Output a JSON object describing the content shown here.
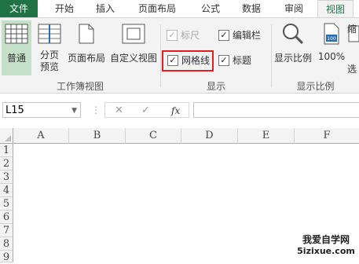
{
  "tabs": [
    "文件",
    "开始",
    "插入",
    "页面布局",
    "公式",
    "数据",
    "审阅",
    "视图"
  ],
  "active_tab": "视图",
  "workbook_views": {
    "group_label": "工作簿视图",
    "normal": "普通",
    "page_break_1": "分页",
    "page_break_2": "预览",
    "page_layout": "页面布局",
    "custom_views": "自定义视图"
  },
  "show": {
    "group_label": "显示",
    "ruler": {
      "label": "标尺",
      "checked": true,
      "disabled": true
    },
    "formula_bar": {
      "label": "编辑栏",
      "checked": true
    },
    "gridlines": {
      "label": "网格线",
      "checked": true
    },
    "headings": {
      "label": "标题",
      "checked": true
    }
  },
  "zoom": {
    "group_label": "显示比例",
    "zoom_label": "显示比例",
    "hundred_label": "100%",
    "hundred_icon_text": "100",
    "selection_1": "缩",
    "selection_2": "选"
  },
  "formula_bar": {
    "name_box_value": "L15",
    "cancel_symbol": "✕",
    "enter_symbol": "✓",
    "fx_symbol": "fx",
    "formula_value": ""
  },
  "columns": [
    "A",
    "B",
    "C",
    "D",
    "E",
    "F"
  ],
  "rows": [
    "1",
    "2",
    "3",
    "4",
    "5",
    "6",
    "7",
    "8",
    "9"
  ],
  "watermark": {
    "line1": "我爱自学网",
    "line2": "5izixue.com"
  },
  "colors": {
    "file_tab": "#217346",
    "ribbon_bg": "#f3f3f3",
    "highlight_border": "#e02020",
    "active_tab_text": "#217346"
  }
}
